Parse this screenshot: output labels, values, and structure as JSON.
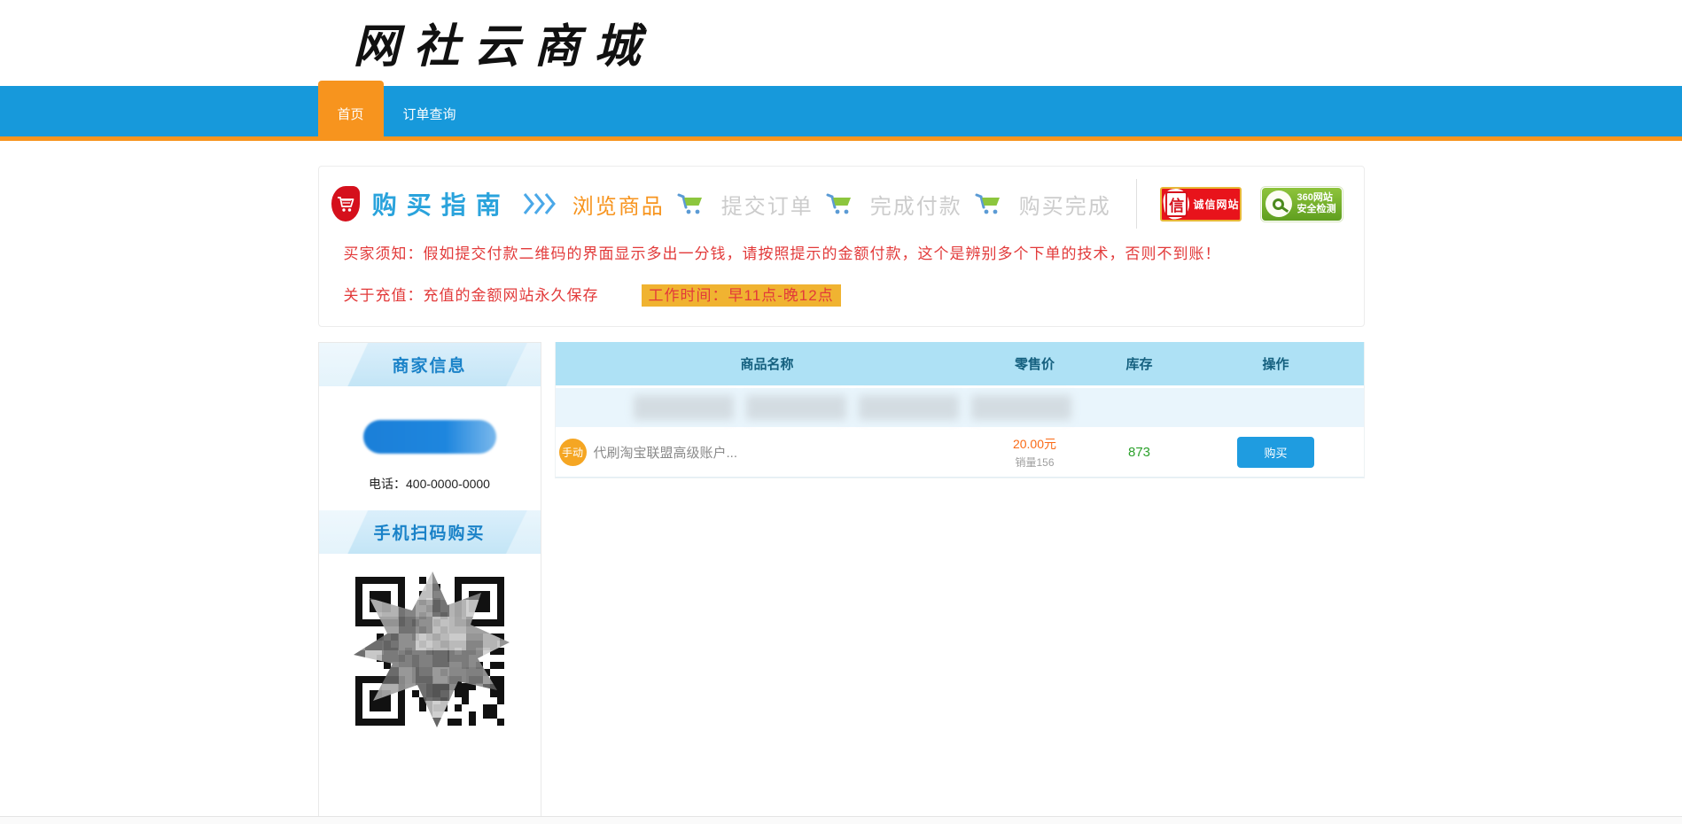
{
  "header": {
    "logo": "网社云商城"
  },
  "nav": {
    "items": [
      {
        "label": "首页",
        "active": true
      },
      {
        "label": "订单查询",
        "active": false
      }
    ]
  },
  "guide": {
    "title": "购买指南",
    "steps": [
      "浏览商品",
      "提交订单",
      "完成付款",
      "购买完成"
    ],
    "current_step": "浏览商品",
    "badges": {
      "integrity": {
        "icon_char": "信",
        "label": "诚信网站"
      },
      "safety": {
        "line1": "360网站",
        "line2": "安全检测"
      }
    },
    "notice_buyer": "买家须知：假如提交付款二维码的界面显示多出一分钱，请按照提示的金额付款，这个是辨别多个下单的技术，否则不到账！",
    "notice_recharge": "关于充值：充值的金额网站永久保存",
    "work_hours": "工作时间：早11点-晚12点"
  },
  "sidebar": {
    "merchant_title": "商家信息",
    "phone_label": "电话：",
    "phone_number": "400-0000-0000",
    "qr_title": "手机扫码购买"
  },
  "table": {
    "headers": [
      "商品名称",
      "零售价",
      "库存",
      "操作"
    ],
    "products": [
      {
        "badge": "手动",
        "name": "代刷淘宝联盟高级账户...",
        "price": "20.00元",
        "sales": "销量156",
        "stock": "873",
        "action": "购买"
      }
    ]
  },
  "colors": {
    "nav_blue": "#1799db",
    "accent_orange": "#f7941e",
    "notice_red": "#e23a3a",
    "highlight_amber": "#f0b331",
    "table_head_blue": "#aee1f5",
    "price_orange": "#fa6a16",
    "stock_green": "#2ca12c",
    "buy_blue": "#1f9ce0"
  }
}
